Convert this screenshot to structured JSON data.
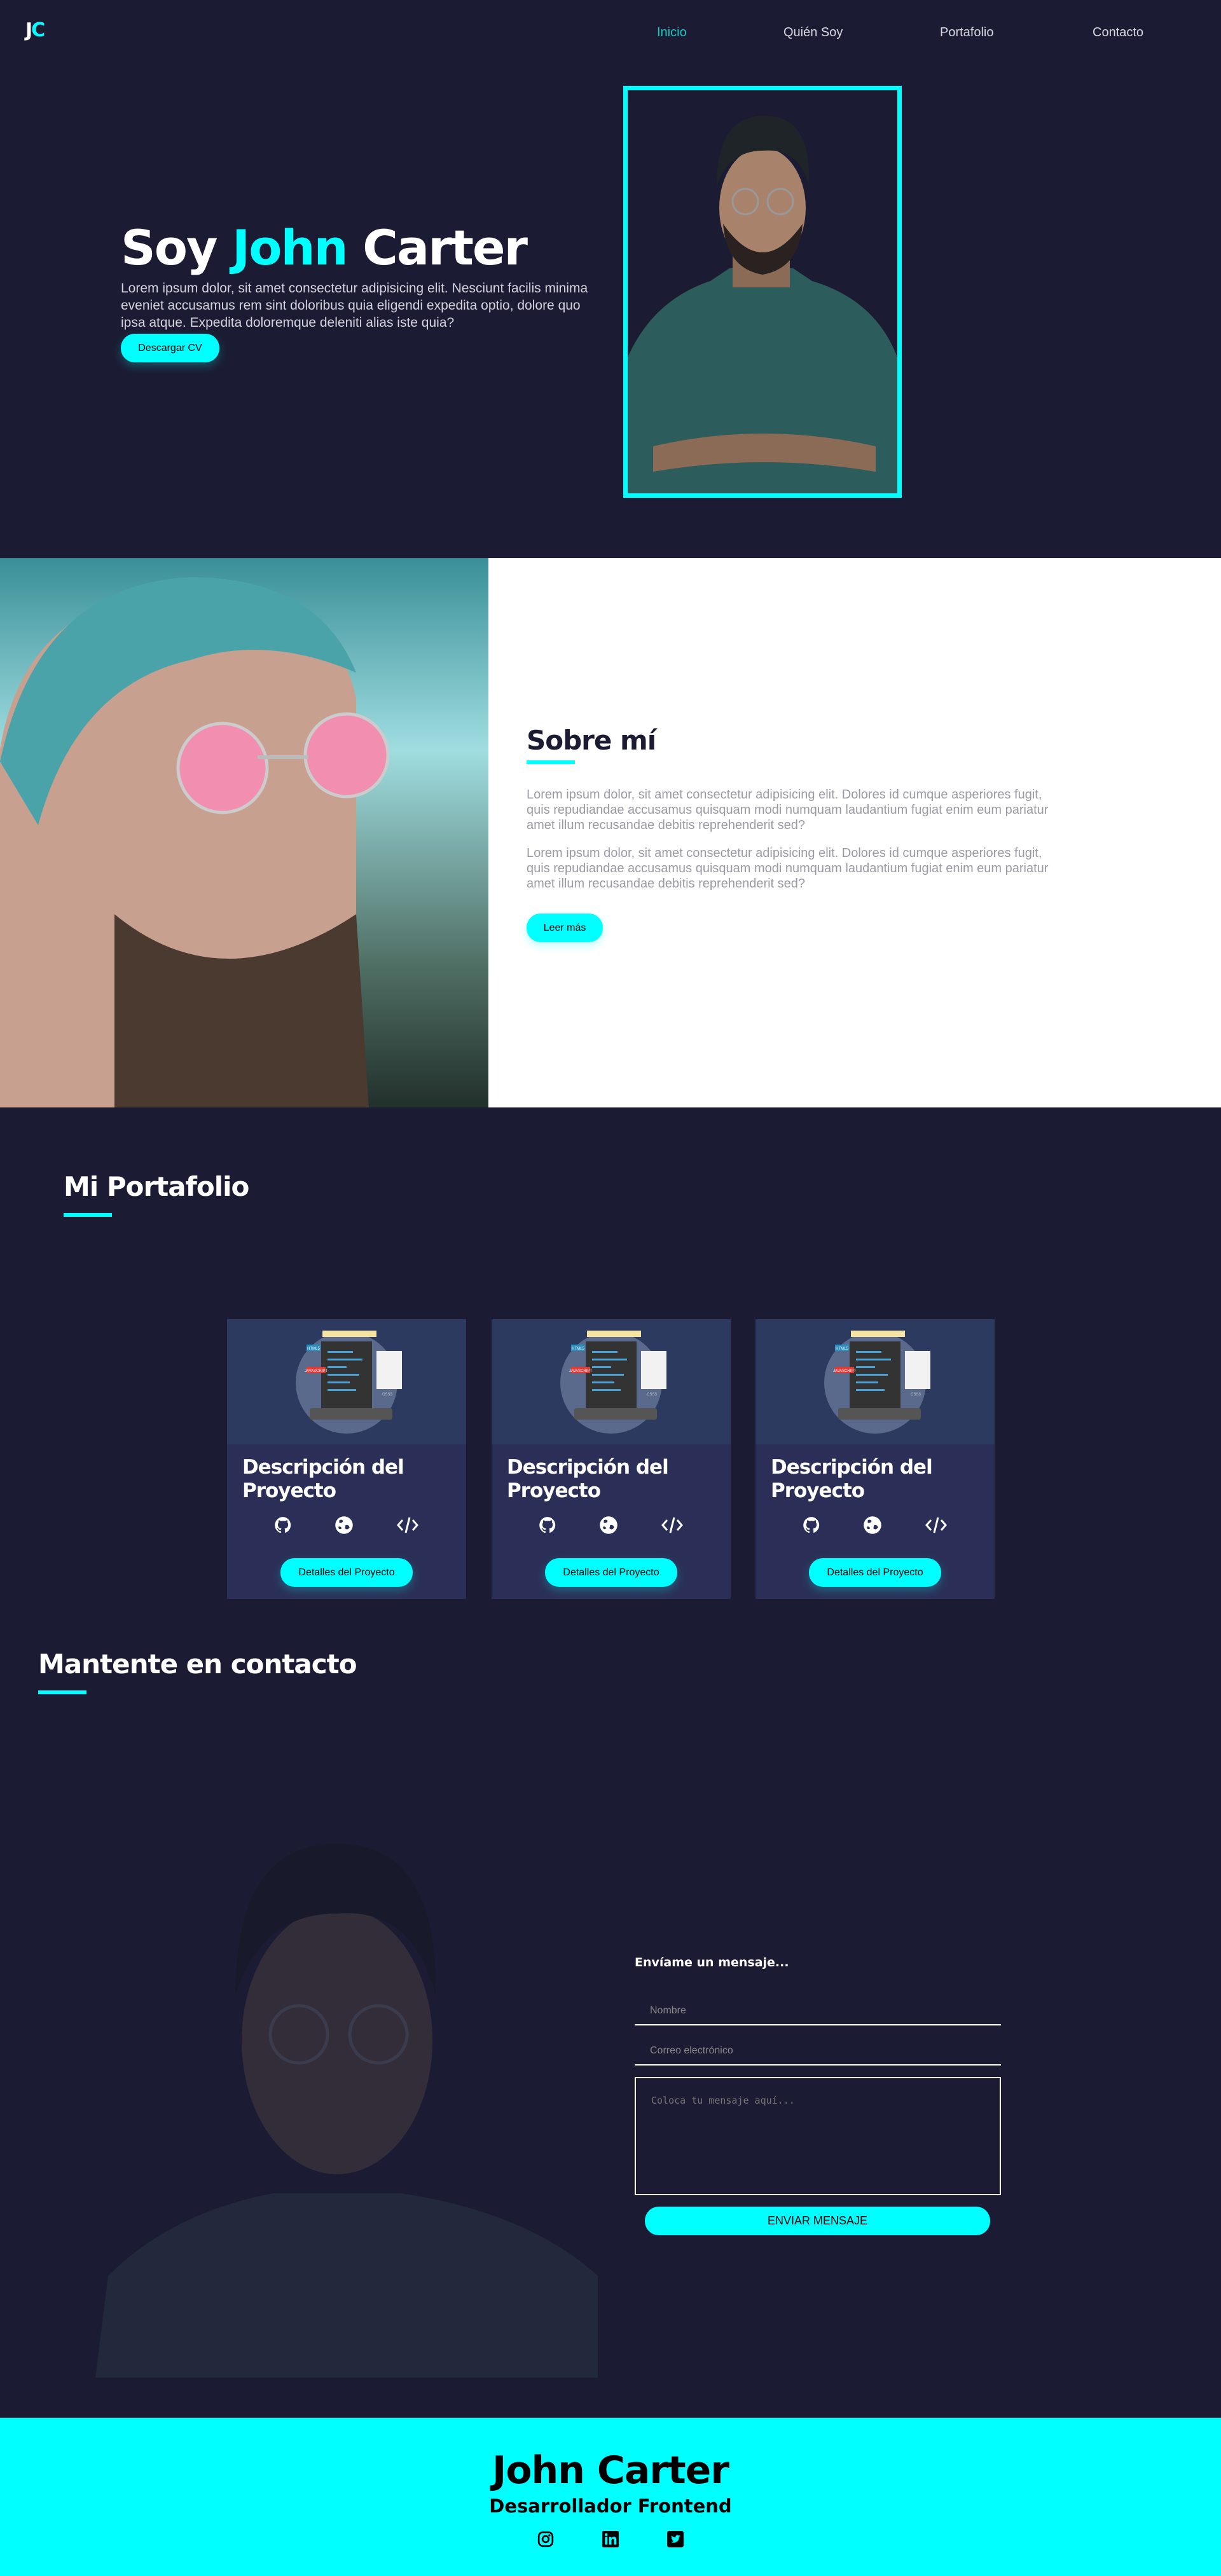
{
  "nav": {
    "logo_j": "J",
    "logo_c": "C",
    "links": [
      "Inicio",
      "Quién Soy",
      "Portafolio",
      "Contacto"
    ],
    "active": "Inicio"
  },
  "hero": {
    "title_pre": "Soy ",
    "title_name": "John",
    "title_post": " Carter",
    "text": "Lorem ipsum dolor, sit amet consectetur adipisicing elit. Nesciunt facilis minima eveniet accusamus rem sint doloribus quia eligendi expedita optio, dolore quo ipsa atque. Expedita doloremque deleniti alias iste quia?",
    "button": "Descargar CV"
  },
  "about": {
    "title": "Sobre mí",
    "paragraphs": [
      "Lorem ipsum dolor, sit amet consectetur adipisicing elit. Dolores id cumque asperiores fugit, quis repudiandae accusamus quisquam modi numquam laudantium fugiat enim eum pariatur amet illum recusandae debitis reprehenderit sed?",
      "Lorem ipsum dolor, sit amet consectetur adipisicing elit. Dolores id cumque asperiores fugit, quis repudiandae accusamus quisquam modi numquam laudantium fugiat enim eum pariatur amet illum recusandae debitis reprehenderit sed?"
    ],
    "button": "Leer más"
  },
  "portfolio": {
    "title": "Mi Portafolio",
    "cards": [
      {
        "title": "Descripción del Proyecto",
        "button": "Detalles del Proyecto",
        "icons": [
          "github-icon",
          "globe-icon",
          "code-icon"
        ]
      },
      {
        "title": "Descripción del Proyecto",
        "button": "Detalles del Proyecto",
        "icons": [
          "github-icon",
          "globe-icon",
          "code-icon"
        ]
      },
      {
        "title": "Descripción del Proyecto",
        "button": "Detalles del Proyecto",
        "icons": [
          "github-icon",
          "globe-icon",
          "code-icon"
        ]
      }
    ],
    "illustration_labels": [
      "HTML5",
      "JAVASCRIPT",
      "CSS3"
    ]
  },
  "contact": {
    "title": "Mantente en contacto",
    "form_title": "Envíame un mensaje...",
    "name_placeholder": "Nombre",
    "email_placeholder": "Correo electrónico",
    "message_placeholder": "Coloca tu mensaje aquí...",
    "button": "ENVIAR MENSAJE"
  },
  "footer": {
    "name": "John Carter",
    "role": "Desarrollador Frontend",
    "social": [
      "instagram-icon",
      "linkedin-icon",
      "twitter-icon"
    ]
  },
  "colors": {
    "accent": "#00ffff",
    "background": "#1b1c33",
    "card": "#2b2f57"
  }
}
